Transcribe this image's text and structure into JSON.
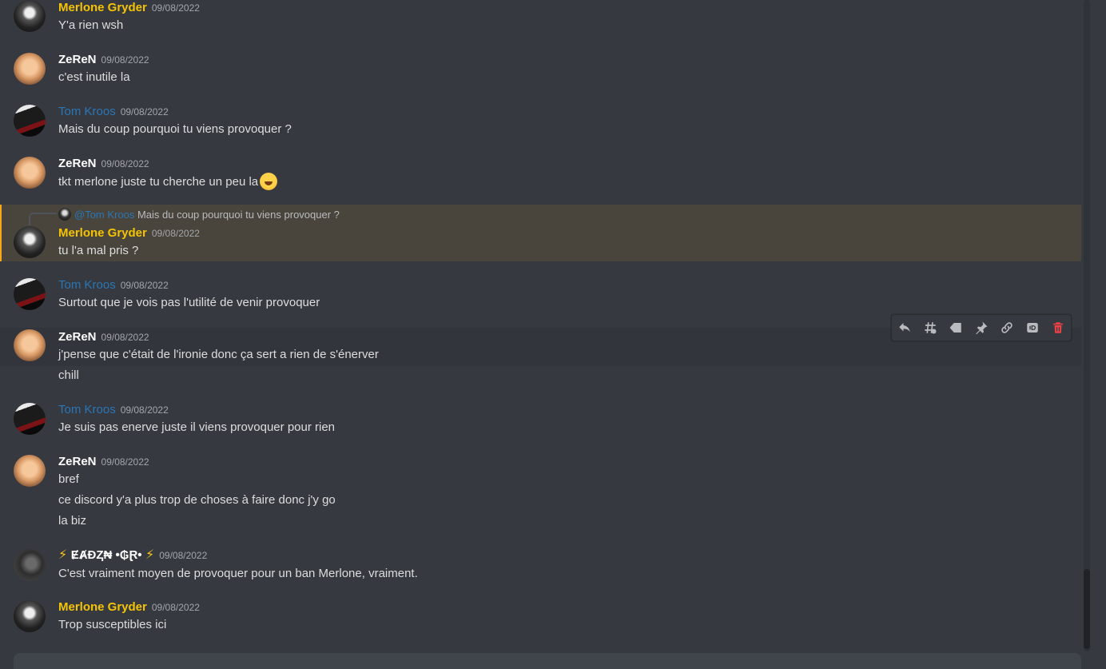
{
  "messages": [
    {
      "author": "Merlone Gryder",
      "timestamp": "09/08/2022",
      "lines": [
        "Y'a rien wsh"
      ]
    },
    {
      "author": "ZeReN",
      "timestamp": "09/08/2022",
      "lines": [
        "c'est inutile la"
      ]
    },
    {
      "author": "Tom Kroos",
      "timestamp": "09/08/2022",
      "lines": [
        "Mais du coup pourquoi tu viens provoquer ?"
      ]
    },
    {
      "author": "ZeReN",
      "timestamp": "09/08/2022",
      "lines": [
        "tkt merlone juste tu cherche un peu la"
      ],
      "emoji": "rolling-on-floor-laughing"
    },
    {
      "author": "Merlone Gryder",
      "timestamp": "09/08/2022",
      "lines": [
        "tu l'a mal pris ?"
      ],
      "reply": {
        "mention": "@Tom Kroos",
        "text": "Mais du coup pourquoi tu viens provoquer ?"
      }
    },
    {
      "author": "Tom Kroos",
      "timestamp": "09/08/2022",
      "lines": [
        "Surtout que je vois pas l'utilité de venir provoquer"
      ]
    },
    {
      "author": "ZeReN",
      "timestamp": "09/08/2022",
      "lines": [
        "j'pense que c'était de l'ironie donc ça sert a rien de s'énerver",
        "chill"
      ]
    },
    {
      "author": "Tom Kroos",
      "timestamp": "09/08/2022",
      "lines": [
        "Je suis pas enerve juste il viens provoquer pour rien"
      ]
    },
    {
      "author": "ZeReN",
      "timestamp": "09/08/2022",
      "lines": [
        "bref",
        "ce discord y'a plus trop de choses à faire donc j'y go",
        "la biz"
      ]
    },
    {
      "author": "ɆȺĐⱫ₦ •₲Ɽ•",
      "timestamp": "09/08/2022",
      "lines": [
        "C'est vraiment moyen de provoquer pour un ban Merlone, vraiment."
      ]
    },
    {
      "author": "Merlone Gryder",
      "timestamp": "09/08/2022",
      "lines": [
        "Trop susceptibles ici"
      ]
    }
  ],
  "bolt": "⚡",
  "colors": {
    "background": "#36393f",
    "highlight": "#49443c",
    "highlight_bar": "#faa81a",
    "gold_name": "#f5c400",
    "blue_name": "#2a76b6",
    "delete_red": "#ed4245"
  },
  "toolbar_icons": [
    "reply-icon",
    "thread-icon",
    "tag-icon",
    "pin-icon",
    "link-icon",
    "id-icon",
    "trash-icon"
  ]
}
